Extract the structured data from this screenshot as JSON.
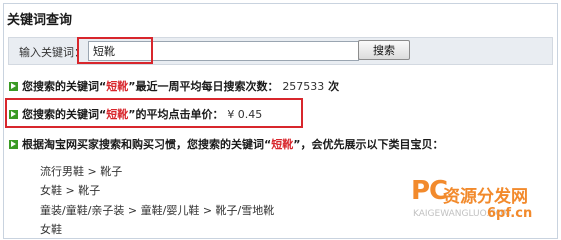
{
  "title": "关键词查询",
  "search": {
    "label": "输入关键词：",
    "value": "短靴",
    "button": "搜索"
  },
  "results": {
    "row1": {
      "prefix": "您搜索的关键词“",
      "keyword": "短靴",
      "suffix": "”最近一周平均每日搜索次数：",
      "value": "257533",
      "unit": "次"
    },
    "row2": {
      "prefix": "您搜索的关键词“",
      "keyword": "短靴",
      "suffix": "”的平均点击单价：",
      "value": "¥ 0.45"
    },
    "row3": {
      "prefix": "根据淘宝网买家搜索和购买习惯，您搜索的关键词“",
      "keyword": "短靴",
      "suffix": "”，会优先展示以下类目宝贝："
    }
  },
  "categories": [
    "流行男鞋 > 靴子",
    "女鞋 > 靴子",
    "童装/童鞋/亲子装 > 童鞋/婴儿鞋 > 靴子/雪地靴",
    "女鞋"
  ],
  "watermark": {
    "logo_big": "PC",
    "logo_cn": "资源分发网",
    "logo_en": "KAIGEWANGLUO.COM",
    "site": "6pf.cn"
  },
  "colors": {
    "highlight_red": "#d8262c",
    "arrow_green": "#3a9a24",
    "watermark_orange": "#f28a2c"
  }
}
